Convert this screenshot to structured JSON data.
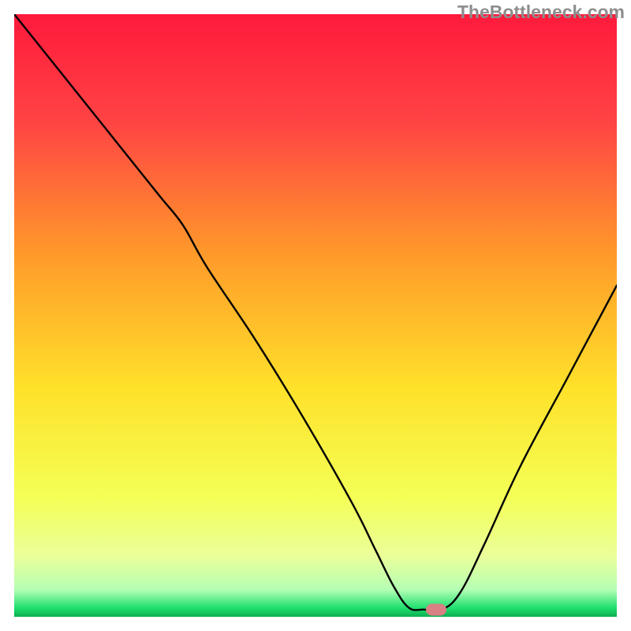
{
  "watermark": "TheBottleneck.com",
  "chart_data": {
    "type": "line",
    "title": "",
    "xlabel": "",
    "ylabel": "",
    "xlim": [
      0,
      100
    ],
    "ylim": [
      0,
      100
    ],
    "axis_visible": false,
    "grid": false,
    "background_gradient": {
      "stops": [
        {
          "pos": 0.0,
          "color": "#ff1a3c"
        },
        {
          "pos": 0.18,
          "color": "#ff4444"
        },
        {
          "pos": 0.4,
          "color": "#ff9a2a"
        },
        {
          "pos": 0.62,
          "color": "#ffe12a"
        },
        {
          "pos": 0.8,
          "color": "#f4ff55"
        },
        {
          "pos": 0.9,
          "color": "#eaff9a"
        },
        {
          "pos": 0.955,
          "color": "#b4ffb4"
        },
        {
          "pos": 0.985,
          "color": "#20e070"
        },
        {
          "pos": 1.0,
          "color": "#0cb050"
        }
      ]
    },
    "series": [
      {
        "name": "bottleneck-curve",
        "stroke": "#000000",
        "stroke_width": 2.4,
        "x": [
          0,
          8,
          16,
          24,
          28,
          32,
          40,
          48,
          56,
          60,
          63,
          65.5,
          68,
          71,
          74,
          78,
          84,
          92,
          100
        ],
        "values": [
          100,
          90,
          80,
          70,
          65,
          58,
          46,
          33,
          19,
          11,
          5,
          1.5,
          1.2,
          1.2,
          4,
          12,
          25,
          40,
          55
        ]
      }
    ],
    "marker": {
      "name": "optimal-point",
      "x": 70,
      "y": 1.2,
      "color": "#d98084",
      "shape": "pill"
    }
  }
}
